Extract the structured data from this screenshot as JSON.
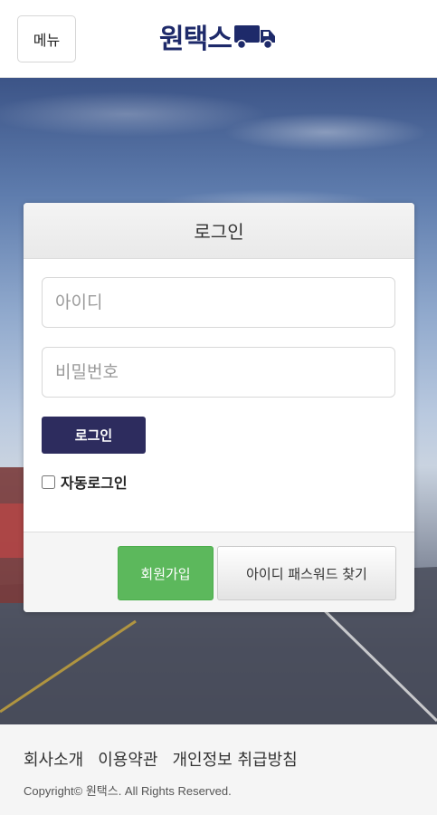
{
  "header": {
    "menu_label": "메뉴",
    "logo_text": "원택스",
    "logo_icon": "truck-icon",
    "brand_color": "#1e2a6a"
  },
  "login": {
    "title": "로그인",
    "userid_placeholder": "아이디",
    "password_placeholder": "비밀번호",
    "submit_label": "로그인",
    "autologin_label": "자동로그인",
    "autologin_checked": false,
    "join_label": "회원가입",
    "find_label": "아이디 패스워드 찾기",
    "submit_color": "#2d2c5e",
    "join_color": "#5cb85c"
  },
  "footer": {
    "links": [
      "회사소개",
      "이용약관",
      "개인정보 취급방침"
    ],
    "copyright": "Copyright© 원택스. All Rights Reserved."
  }
}
